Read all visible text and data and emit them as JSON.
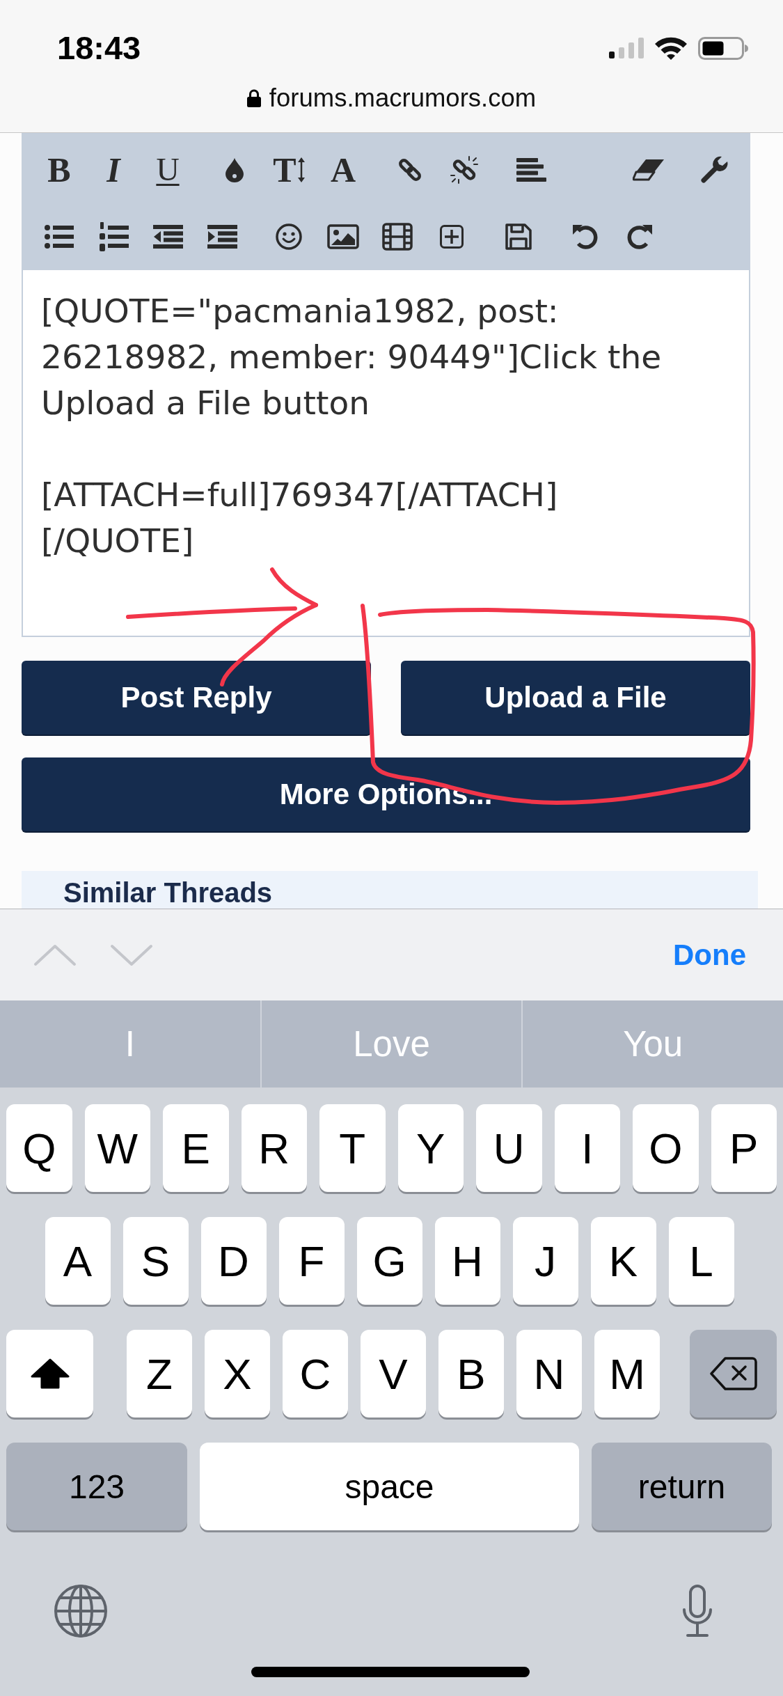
{
  "status_bar": {
    "time": "18:43"
  },
  "browser": {
    "url": "forums.macrumors.com",
    "secure": true
  },
  "editor": {
    "toolbar": {
      "text_buttons": [
        "B",
        "I",
        "U",
        "T",
        "A"
      ]
    },
    "message": {
      "value": "[QUOTE=\"pacmania1982, post: 26218982, member: 90449\"]Click the Upload a File button\n\n[ATTACH=full]769347[/ATTACH]\n[/QUOTE]"
    }
  },
  "buttons": [
    {
      "label": "Post Reply"
    },
    {
      "label": "Upload a File"
    },
    {
      "label": "More Options..."
    }
  ],
  "similar_threads": {
    "title": "Similar Threads"
  },
  "keyboard_accessory": {
    "previous": {
      "disabled": true
    },
    "next": {
      "disabled": true
    },
    "done": "Done"
  },
  "predictions": [
    "I",
    "Love",
    "You"
  ],
  "keyboard": {
    "shift_on": true,
    "rows": [
      [
        "Q",
        "W",
        "E",
        "R",
        "T",
        "Y",
        "U",
        "I",
        "O",
        "P"
      ],
      [
        "A",
        "S",
        "D",
        "F",
        "G",
        "H",
        "J",
        "K",
        "L"
      ],
      [
        "Z",
        "X",
        "C",
        "V",
        "B",
        "N",
        "M"
      ]
    ],
    "numbers_key": "123",
    "space_key": "space",
    "return_key": "return"
  }
}
